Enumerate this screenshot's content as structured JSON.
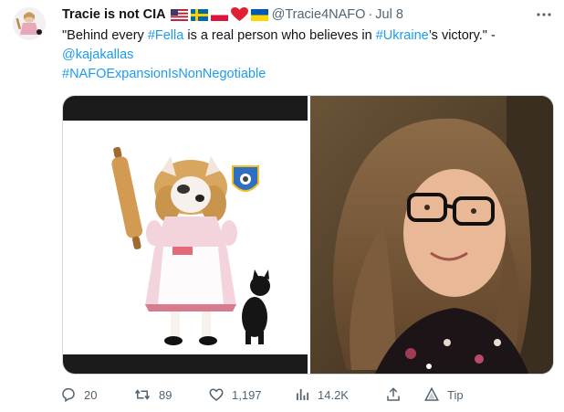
{
  "author": {
    "display_name": "Tracie is not CIA",
    "handle": "@Tracie4NAFO",
    "separator": "·",
    "date": "Jul 8",
    "flags": [
      "us-flag",
      "sweden-flag",
      "poland-flag",
      "red-heart",
      "ukraine-flag"
    ]
  },
  "tweet": {
    "text_1": "\"Behind every ",
    "hashtag_1": "#Fella",
    "text_2": " is a real person who believes in ",
    "hashtag_2": "#Ukraine",
    "text_3": "’s victory.\" -",
    "mention": "@kajakallas",
    "hashtag_3": "#NAFOExpansionIsNonNegotiable"
  },
  "media": {
    "left_image": "fella-meme-dog-in-dress-with-rolling-pin-and-cat",
    "right_image": "photo-woman-with-glasses"
  },
  "actions": {
    "replies": "20",
    "retweets": "89",
    "likes": "1,197",
    "views": "14.2K",
    "tip": "Tip"
  },
  "colors": {
    "link": "#1d9bf0",
    "muted": "#536471",
    "text": "#0f1419"
  },
  "icons": {
    "more": "more-icon",
    "reply": "reply-icon",
    "retweet": "retweet-icon",
    "like": "like-icon",
    "views": "views-icon",
    "share": "share-icon",
    "tip": "tip-icon"
  }
}
